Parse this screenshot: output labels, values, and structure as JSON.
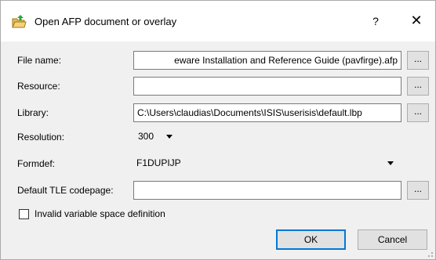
{
  "window": {
    "title": "Open AFP document or overlay",
    "help_label": "?",
    "close_label": "✕",
    "icon": "folder-open-icon"
  },
  "fields": {
    "file_name": {
      "label": "File name:",
      "value": "eware Installation and Reference Guide (pavfirge).afp"
    },
    "resource": {
      "label": "Resource:",
      "value": ""
    },
    "library": {
      "label": "Library:",
      "value": "C:\\Users\\claudias\\Documents\\ISIS\\userisis\\default.lbp"
    },
    "resolution": {
      "label": "Resolution:",
      "value": "300"
    },
    "formdef": {
      "label": "Formdef:",
      "value": "F1DUPIJP"
    },
    "default_tle_codepage": {
      "label": "Default TLE codepage:",
      "value": ""
    }
  },
  "browse_label": "...",
  "checkbox": {
    "label": "Invalid variable space definition",
    "checked": false
  },
  "buttons": {
    "ok": "OK",
    "cancel": "Cancel"
  },
  "colors": {
    "accent": "#0078d7",
    "folder": "#e8b84a",
    "arrow": "#2fa33a"
  }
}
